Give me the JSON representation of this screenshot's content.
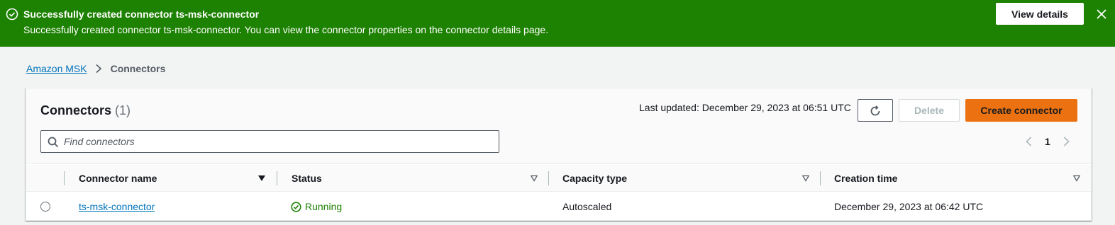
{
  "flash": {
    "title": "Successfully created connector ts-msk-connector",
    "message": "Successfully created connector ts-msk-connector. You can view the connector properties on the connector details page.",
    "button_label": "View details",
    "icons": {
      "status": "success-check-icon",
      "dismiss": "close-icon"
    },
    "color": "#1d8102"
  },
  "breadcrumb": {
    "items": [
      {
        "label": "Amazon MSK"
      },
      {
        "label": "Connectors"
      }
    ]
  },
  "panel": {
    "title": "Connectors",
    "count": "(1)",
    "last_updated": "Last updated: December 29, 2023 at 06:51 UTC",
    "delete_label": "Delete",
    "create_label": "Create connector",
    "search_placeholder": "Find connectors",
    "page_number": "1",
    "accent_color": "#ec7211"
  },
  "table": {
    "columns": [
      "Connector name",
      "Status",
      "Capacity type",
      "Creation time"
    ],
    "rows": [
      {
        "name": "ts-msk-connector",
        "status": "Running",
        "capacity": "Autoscaled",
        "created": "December 29, 2023 at 06:42 UTC"
      }
    ]
  }
}
